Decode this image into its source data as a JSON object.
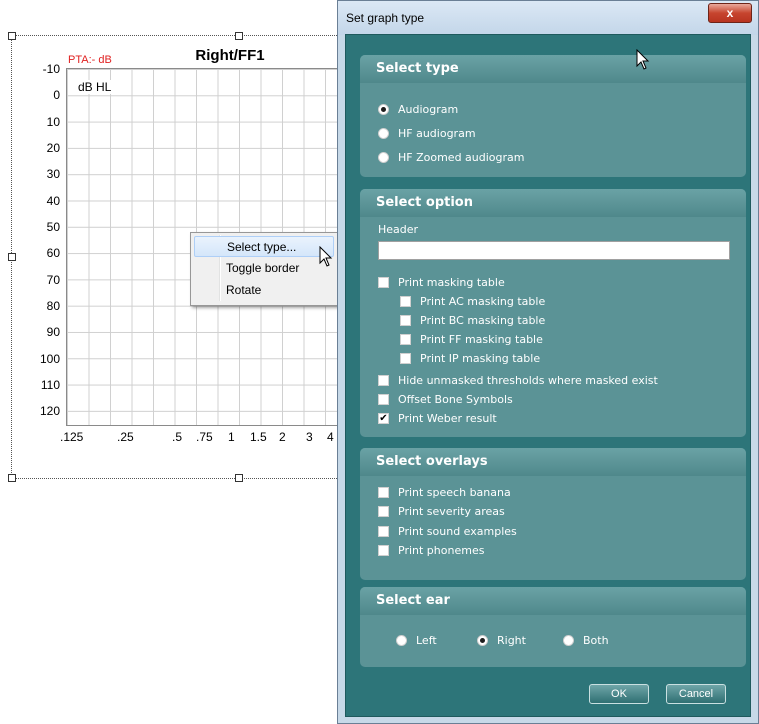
{
  "audiogram": {
    "title": "Right/FF1",
    "pta": "PTA:- dB",
    "unit": "dB HL",
    "y_ticks": [
      "-10",
      "0",
      "10",
      "20",
      "30",
      "40",
      "50",
      "60",
      "70",
      "80",
      "90",
      "100",
      "110",
      "120"
    ],
    "x_ticks": [
      ".125",
      ".25",
      ".5",
      ".75",
      "1",
      "1.5",
      "2",
      "3",
      "4"
    ]
  },
  "context_menu": {
    "items": [
      "Select type...",
      "Toggle border",
      "Rotate"
    ]
  },
  "dialog": {
    "title": "Set graph type",
    "close_label": "x",
    "select_type": {
      "heading": "Select type",
      "options": [
        "Audiogram",
        "HF audiogram",
        "HF Zoomed audiogram"
      ],
      "selected": "Audiogram"
    },
    "select_option": {
      "heading": "Select option",
      "header_label": "Header",
      "header_value": "",
      "print_masking_table": "Print masking table",
      "masking_sub": [
        "Print AC masking table",
        "Print BC masking table",
        "Print FF masking table",
        "Print IP masking table"
      ],
      "hide_unmasked": "Hide unmasked thresholds where masked exist",
      "offset_bone": "Offset Bone Symbols",
      "print_weber": "Print Weber result"
    },
    "select_overlays": {
      "heading": "Select overlays",
      "items": [
        "Print speech banana",
        "Print severity areas",
        "Print sound examples",
        "Print phonemes"
      ]
    },
    "select_ear": {
      "heading": "Select ear",
      "options": [
        "Left",
        "Right",
        "Both"
      ],
      "selected": "Right"
    },
    "buttons": {
      "ok": "OK",
      "cancel": "Cancel"
    }
  }
}
